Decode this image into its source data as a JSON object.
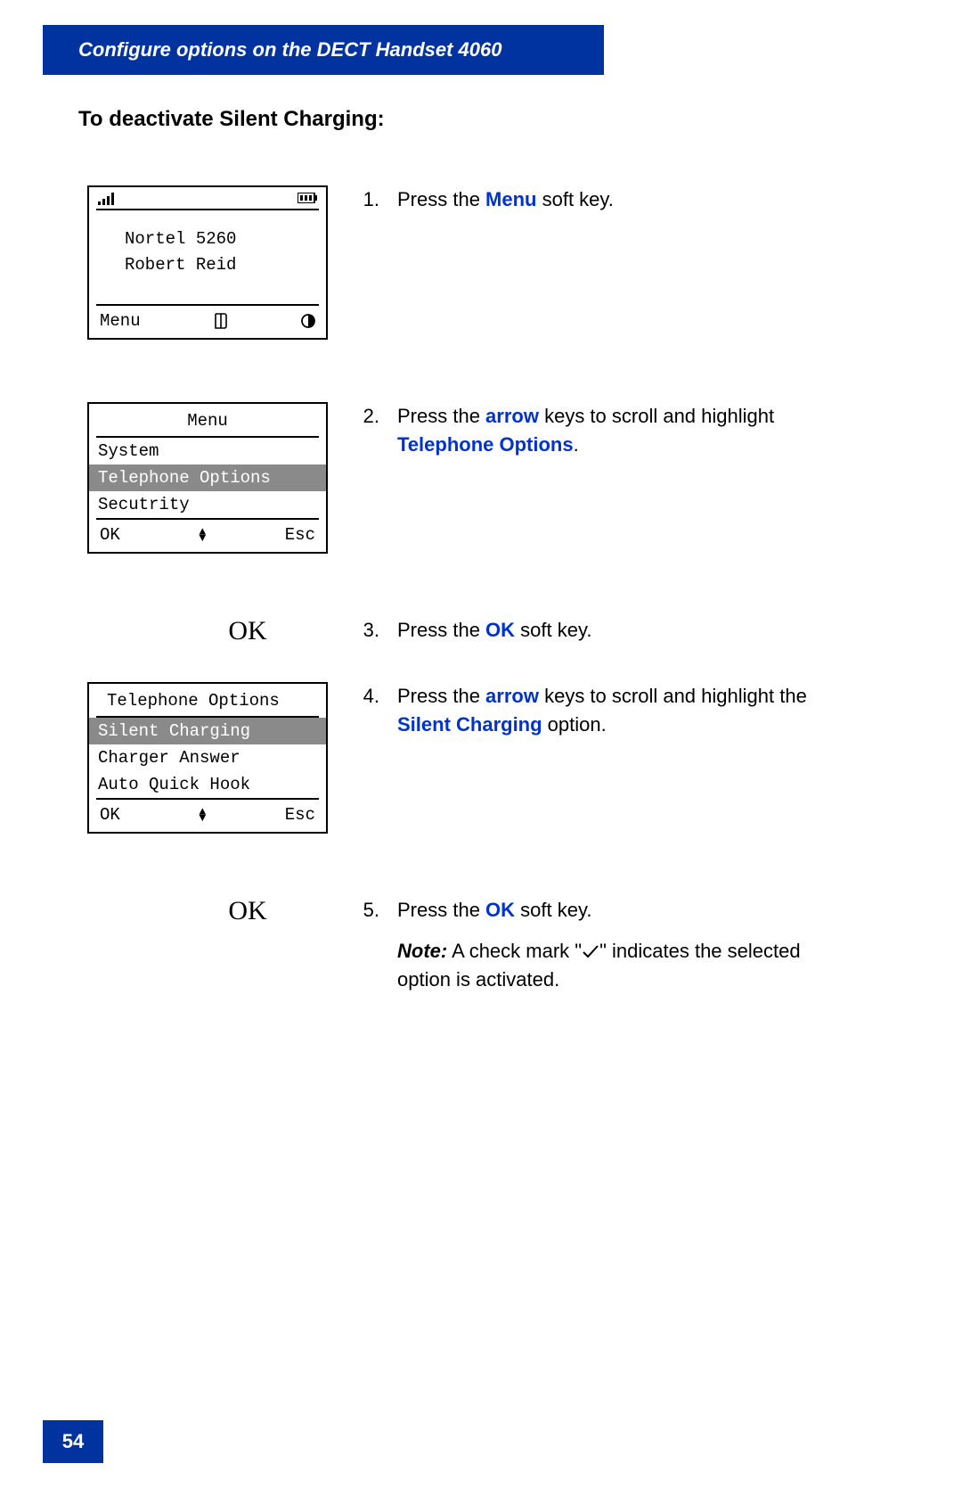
{
  "header": {
    "title": "Configure options on the DECT Handset 4060"
  },
  "section_title": "To deactivate Silent Charging:",
  "screens": {
    "idle": {
      "line1": "Nortel 5260",
      "line2": "Robert Reid",
      "softkey_left": "Menu"
    },
    "menu": {
      "title": "Menu",
      "items": [
        "System",
        "Telephone Options",
        "Secutrity"
      ],
      "softkey_left": "OK",
      "softkey_right": "Esc"
    },
    "telopts": {
      "title": "Telephone Options",
      "items": [
        "Silent Charging",
        "Charger Answer",
        "Auto Quick Hook"
      ],
      "softkey_left": "OK",
      "softkey_right": "Esc"
    }
  },
  "ok_label": "OK",
  "steps": {
    "s1": {
      "num": "1.",
      "pre": "Press the ",
      "hl": "Menu",
      "post": " soft key."
    },
    "s2": {
      "num": "2.",
      "pre": "Press the ",
      "hl1": "arrow",
      "mid": " keys to scroll and highlight ",
      "hl2": "Telephone Options",
      "post": "."
    },
    "s3": {
      "num": "3.",
      "pre": "Press the ",
      "hl": "OK",
      "post": " soft key."
    },
    "s4": {
      "num": "4.",
      "pre": "Press the ",
      "hl1": "arrow",
      "mid": " keys to scroll and highlight the ",
      "hl2": "Silent Charging",
      "post": " option."
    },
    "s5": {
      "num": "5.",
      "pre": "Press the ",
      "hl": "OK",
      "post": " soft key.",
      "note_label": "Note:",
      "note_pre": " A check mark \"",
      "note_post": "\" indicates the selected option is activated."
    }
  },
  "page_number": "54"
}
